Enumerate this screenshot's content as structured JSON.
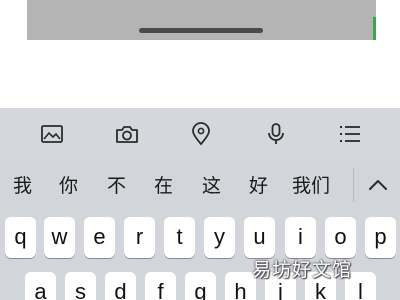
{
  "top_panel": {
    "bottom_tabs": [
      {
        "label": ""
      },
      {
        "label": ""
      },
      {
        "label": ""
      },
      {
        "label": ""
      }
    ],
    "colors": {
      "panel": "#b4b4b4",
      "indicator": "#4a4a4a",
      "accent": "#3aa84a"
    }
  },
  "keyboard": {
    "toolbar": [
      {
        "icon": "image-icon"
      },
      {
        "icon": "camera-icon"
      },
      {
        "icon": "location-pin-icon"
      },
      {
        "icon": "microphone-icon"
      },
      {
        "icon": "list-icon"
      }
    ],
    "candidates": [
      "我",
      "你",
      "不",
      "在",
      "这",
      "好",
      "我们"
    ],
    "collapse_icon": "chevron-up-icon",
    "row1": [
      "q",
      "w",
      "e",
      "r",
      "t",
      "y",
      "u",
      "i",
      "o",
      "p"
    ],
    "row2": [
      "a",
      "s",
      "d",
      "f",
      "g",
      "h",
      "j",
      "k",
      "l"
    ],
    "colors": {
      "background": "#d2d5da",
      "key": "#ffffff",
      "icon": "#2b2b2b"
    }
  },
  "watermark": {
    "text": "易坊好文馆"
  }
}
